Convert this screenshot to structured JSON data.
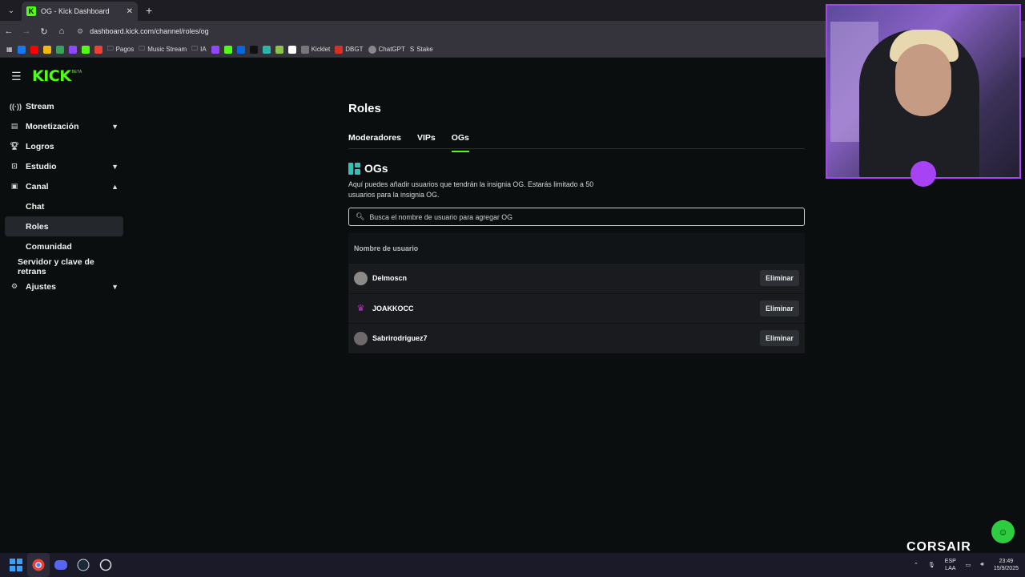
{
  "browser": {
    "tab_title": "OG - Kick Dashboard",
    "url": "dashboard.kick.com/channel/roles/og",
    "bookmarks": [
      "Pagos",
      "Music Stream",
      "IA",
      "Kicklet",
      "DBGT",
      "ChatGPT",
      "Stake"
    ]
  },
  "sidebar": {
    "items": [
      {
        "label": "Stream",
        "icon": "broadcast-icon"
      },
      {
        "label": "Monetización",
        "icon": "monetization-icon"
      },
      {
        "label": "Logros",
        "icon": "trophy-icon"
      },
      {
        "label": "Estudio",
        "icon": "studio-icon"
      },
      {
        "label": "Canal",
        "icon": "channel-icon"
      },
      {
        "label": "Chat"
      },
      {
        "label": "Roles"
      },
      {
        "label": "Comunidad"
      },
      {
        "label": "Servidor y clave de retrans"
      },
      {
        "label": "Ajustes",
        "icon": "gear-icon"
      }
    ]
  },
  "main": {
    "title": "Roles",
    "tabs": [
      "Moderadores",
      "VIPs",
      "OGs"
    ],
    "section_title": "OGs",
    "description": "Aquí puedes añadir usuarios que tendrán la insignia OG. Estarás limitado a 50 usuarios para la insignia OG.",
    "search_placeholder": "Busca el nombre de usuario para agregar OG",
    "table_header": "Nombre de usuario",
    "rows": [
      {
        "username": "Delmoscn",
        "action": "Eliminar"
      },
      {
        "username": "JOAKKOCC",
        "action": "Eliminar"
      },
      {
        "username": "Sabrirodriguez7",
        "action": "Eliminar"
      }
    ]
  },
  "overlay": {
    "brand": "CORSAIR"
  },
  "taskbar": {
    "lang_top": "ESP",
    "lang_bottom": "LAA",
    "time": "23:49",
    "date": "15/9/2025"
  }
}
